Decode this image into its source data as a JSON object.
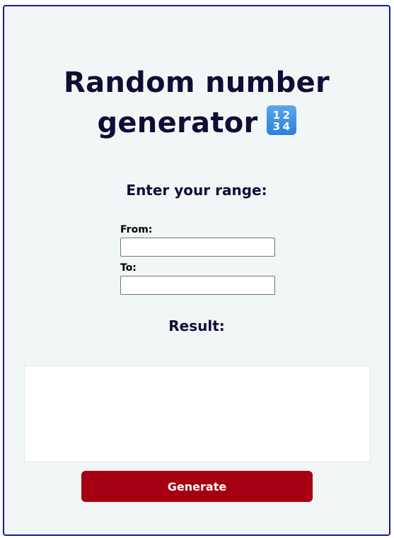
{
  "title": {
    "line1": "Random number",
    "line2": "generator",
    "emoji": "1234",
    "emoji_icon": "input-numbers-icon",
    "emoji_color": "#3c8ee3"
  },
  "range": {
    "heading": "Enter your range:",
    "from_label": "From:",
    "from_value": "",
    "to_label": "To:",
    "to_value": ""
  },
  "result": {
    "heading": "Result:",
    "value": ""
  },
  "generate_button": {
    "label": "Generate",
    "color": "#a50011"
  },
  "colors": {
    "card_border": "#1a1a8c",
    "card_background": "#f1f7f6",
    "text": "#0d0d35"
  }
}
